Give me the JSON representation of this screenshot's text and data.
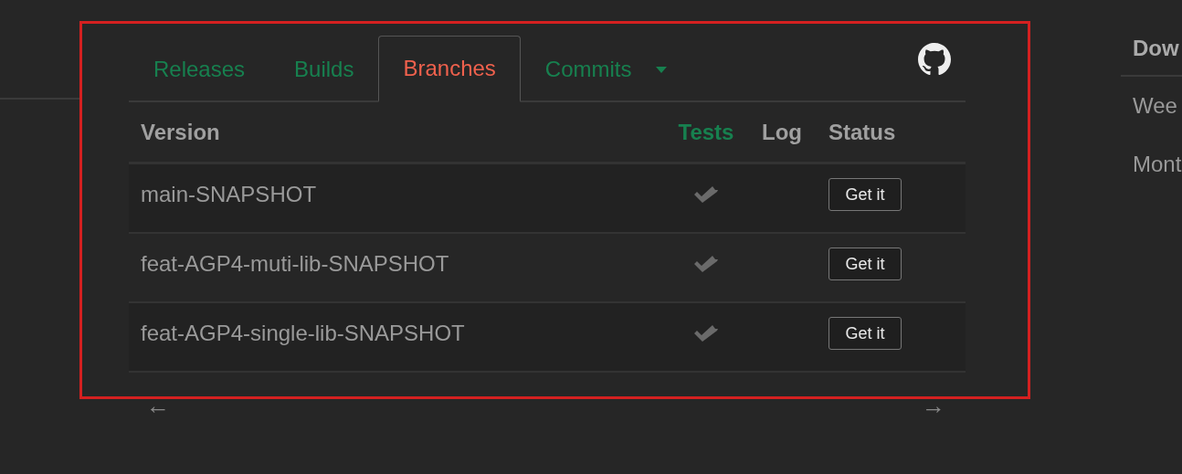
{
  "tabs": [
    {
      "label": "Releases",
      "selected": false,
      "menu": false
    },
    {
      "label": "Builds",
      "selected": false,
      "menu": false
    },
    {
      "label": "Branches",
      "selected": true,
      "menu": false
    },
    {
      "label": "Commits",
      "selected": false,
      "menu": true
    }
  ],
  "table": {
    "columns": [
      {
        "label": "Version",
        "highlighted": false
      },
      {
        "label": "Tests",
        "highlighted": true
      },
      {
        "label": "Log",
        "highlighted": false
      },
      {
        "label": "Status",
        "highlighted": false
      }
    ],
    "rows": [
      {
        "version": "main-SNAPSHOT",
        "tests_passed": true,
        "action": "Get it"
      },
      {
        "version": "feat-AGP4-muti-lib-SNAPSHOT",
        "tests_passed": true,
        "action": "Get it"
      },
      {
        "version": "feat-AGP4-single-lib-SNAPSHOT",
        "tests_passed": true,
        "action": "Get it"
      }
    ]
  },
  "pager": {
    "previous": "←",
    "next": "→"
  },
  "side_panel": {
    "heading": "Dow",
    "items": [
      "Wee",
      "Mont"
    ]
  }
}
